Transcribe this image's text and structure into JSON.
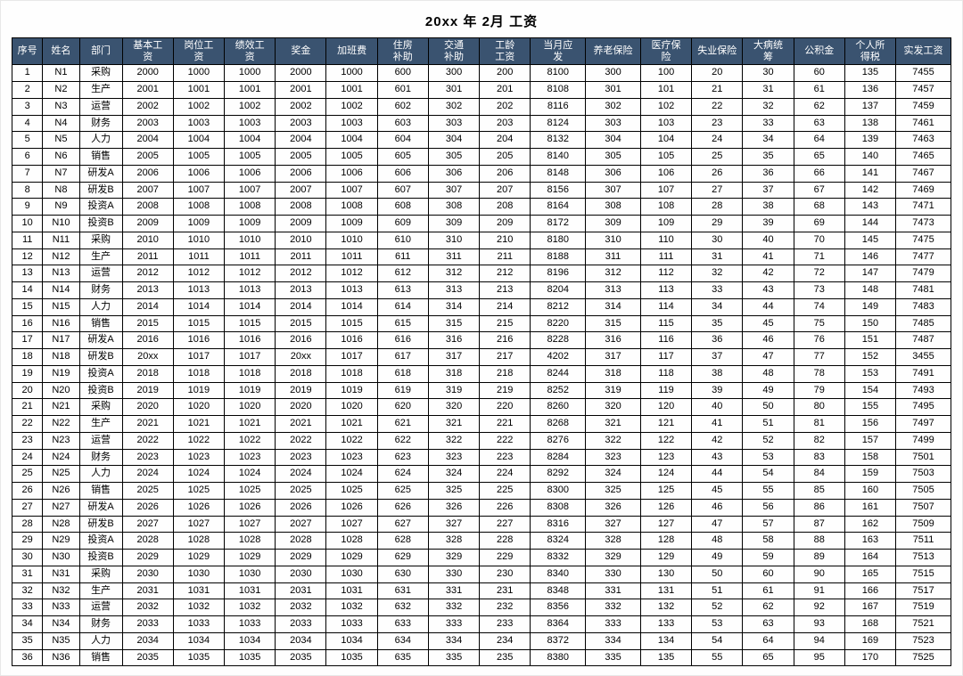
{
  "title": "20xx  年  2月 工资",
  "headers": [
    "序号",
    "姓名",
    "部门",
    "基本工资",
    "岗位工资",
    "绩效工资",
    "奖金",
    "加班费",
    "住房补助",
    "交通补助",
    "工龄工资",
    "当月应发",
    "养老保险",
    "医疗保险",
    "失业保险",
    "大病统筹",
    "公积金",
    "个人所得税",
    "实发工资"
  ],
  "rows": [
    [
      1,
      "N1",
      "采购",
      2000,
      1000,
      1000,
      2000,
      1000,
      600,
      300,
      200,
      8100,
      300,
      100,
      20,
      30,
      60,
      135,
      7455
    ],
    [
      2,
      "N2",
      "生产",
      2001,
      1001,
      1001,
      2001,
      1001,
      601,
      301,
      201,
      8108,
      301,
      101,
      21,
      31,
      61,
      136,
      7457
    ],
    [
      3,
      "N3",
      "运营",
      2002,
      1002,
      1002,
      2002,
      1002,
      602,
      302,
      202,
      8116,
      302,
      102,
      22,
      32,
      62,
      137,
      7459
    ],
    [
      4,
      "N4",
      "财务",
      2003,
      1003,
      1003,
      2003,
      1003,
      603,
      303,
      203,
      8124,
      303,
      103,
      23,
      33,
      63,
      138,
      7461
    ],
    [
      5,
      "N5",
      "人力",
      2004,
      1004,
      1004,
      2004,
      1004,
      604,
      304,
      204,
      8132,
      304,
      104,
      24,
      34,
      64,
      139,
      7463
    ],
    [
      6,
      "N6",
      "销售",
      2005,
      1005,
      1005,
      2005,
      1005,
      605,
      305,
      205,
      8140,
      305,
      105,
      25,
      35,
      65,
      140,
      7465
    ],
    [
      7,
      "N7",
      "研发A",
      2006,
      1006,
      1006,
      2006,
      1006,
      606,
      306,
      206,
      8148,
      306,
      106,
      26,
      36,
      66,
      141,
      7467
    ],
    [
      8,
      "N8",
      "研发B",
      2007,
      1007,
      1007,
      2007,
      1007,
      607,
      307,
      207,
      8156,
      307,
      107,
      27,
      37,
      67,
      142,
      7469
    ],
    [
      9,
      "N9",
      "投资A",
      2008,
      1008,
      1008,
      2008,
      1008,
      608,
      308,
      208,
      8164,
      308,
      108,
      28,
      38,
      68,
      143,
      7471
    ],
    [
      10,
      "N10",
      "投资B",
      2009,
      1009,
      1009,
      2009,
      1009,
      609,
      309,
      209,
      8172,
      309,
      109,
      29,
      39,
      69,
      144,
      7473
    ],
    [
      11,
      "N11",
      "采购",
      2010,
      1010,
      1010,
      2010,
      1010,
      610,
      310,
      210,
      8180,
      310,
      110,
      30,
      40,
      70,
      145,
      7475
    ],
    [
      12,
      "N12",
      "生产",
      2011,
      1011,
      1011,
      2011,
      1011,
      611,
      311,
      211,
      8188,
      311,
      111,
      31,
      41,
      71,
      146,
      7477
    ],
    [
      13,
      "N13",
      "运营",
      2012,
      1012,
      1012,
      2012,
      1012,
      612,
      312,
      212,
      8196,
      312,
      112,
      32,
      42,
      72,
      147,
      7479
    ],
    [
      14,
      "N14",
      "财务",
      2013,
      1013,
      1013,
      2013,
      1013,
      613,
      313,
      213,
      8204,
      313,
      113,
      33,
      43,
      73,
      148,
      7481
    ],
    [
      15,
      "N15",
      "人力",
      2014,
      1014,
      1014,
      2014,
      1014,
      614,
      314,
      214,
      8212,
      314,
      114,
      34,
      44,
      74,
      149,
      7483
    ],
    [
      16,
      "N16",
      "销售",
      2015,
      1015,
      1015,
      2015,
      1015,
      615,
      315,
      215,
      8220,
      315,
      115,
      35,
      45,
      75,
      150,
      7485
    ],
    [
      17,
      "N17",
      "研发A",
      2016,
      1016,
      1016,
      2016,
      1016,
      616,
      316,
      216,
      8228,
      316,
      116,
      36,
      46,
      76,
      151,
      7487
    ],
    [
      18,
      "N18",
      "研发B",
      "20xx",
      1017,
      1017,
      "20xx",
      1017,
      617,
      317,
      217,
      4202,
      317,
      117,
      37,
      47,
      77,
      152,
      3455
    ],
    [
      19,
      "N19",
      "投资A",
      2018,
      1018,
      1018,
      2018,
      1018,
      618,
      318,
      218,
      8244,
      318,
      118,
      38,
      48,
      78,
      153,
      7491
    ],
    [
      20,
      "N20",
      "投资B",
      2019,
      1019,
      1019,
      2019,
      1019,
      619,
      319,
      219,
      8252,
      319,
      119,
      39,
      49,
      79,
      154,
      7493
    ],
    [
      21,
      "N21",
      "采购",
      2020,
      1020,
      1020,
      2020,
      1020,
      620,
      320,
      220,
      8260,
      320,
      120,
      40,
      50,
      80,
      155,
      7495
    ],
    [
      22,
      "N22",
      "生产",
      2021,
      1021,
      1021,
      2021,
      1021,
      621,
      321,
      221,
      8268,
      321,
      121,
      41,
      51,
      81,
      156,
      7497
    ],
    [
      23,
      "N23",
      "运营",
      2022,
      1022,
      1022,
      2022,
      1022,
      622,
      322,
      222,
      8276,
      322,
      122,
      42,
      52,
      82,
      157,
      7499
    ],
    [
      24,
      "N24",
      "财务",
      2023,
      1023,
      1023,
      2023,
      1023,
      623,
      323,
      223,
      8284,
      323,
      123,
      43,
      53,
      83,
      158,
      7501
    ],
    [
      25,
      "N25",
      "人力",
      2024,
      1024,
      1024,
      2024,
      1024,
      624,
      324,
      224,
      8292,
      324,
      124,
      44,
      54,
      84,
      159,
      7503
    ],
    [
      26,
      "N26",
      "销售",
      2025,
      1025,
      1025,
      2025,
      1025,
      625,
      325,
      225,
      8300,
      325,
      125,
      45,
      55,
      85,
      160,
      7505
    ],
    [
      27,
      "N27",
      "研发A",
      2026,
      1026,
      1026,
      2026,
      1026,
      626,
      326,
      226,
      8308,
      326,
      126,
      46,
      56,
      86,
      161,
      7507
    ],
    [
      28,
      "N28",
      "研发B",
      2027,
      1027,
      1027,
      2027,
      1027,
      627,
      327,
      227,
      8316,
      327,
      127,
      47,
      57,
      87,
      162,
      7509
    ],
    [
      29,
      "N29",
      "投资A",
      2028,
      1028,
      1028,
      2028,
      1028,
      628,
      328,
      228,
      8324,
      328,
      128,
      48,
      58,
      88,
      163,
      7511
    ],
    [
      30,
      "N30",
      "投资B",
      2029,
      1029,
      1029,
      2029,
      1029,
      629,
      329,
      229,
      8332,
      329,
      129,
      49,
      59,
      89,
      164,
      7513
    ],
    [
      31,
      "N31",
      "采购",
      2030,
      1030,
      1030,
      2030,
      1030,
      630,
      330,
      230,
      8340,
      330,
      130,
      50,
      60,
      90,
      165,
      7515
    ],
    [
      32,
      "N32",
      "生产",
      2031,
      1031,
      1031,
      2031,
      1031,
      631,
      331,
      231,
      8348,
      331,
      131,
      51,
      61,
      91,
      166,
      7517
    ],
    [
      33,
      "N33",
      "运营",
      2032,
      1032,
      1032,
      2032,
      1032,
      632,
      332,
      232,
      8356,
      332,
      132,
      52,
      62,
      92,
      167,
      7519
    ],
    [
      34,
      "N34",
      "财务",
      2033,
      1033,
      1033,
      2033,
      1033,
      633,
      333,
      233,
      8364,
      333,
      133,
      53,
      63,
      93,
      168,
      7521
    ],
    [
      35,
      "N35",
      "人力",
      2034,
      1034,
      1034,
      2034,
      1034,
      634,
      334,
      234,
      8372,
      334,
      134,
      54,
      64,
      94,
      169,
      7523
    ],
    [
      36,
      "N36",
      "销售",
      2035,
      1035,
      1035,
      2035,
      1035,
      635,
      335,
      235,
      8380,
      335,
      135,
      55,
      65,
      95,
      170,
      7525
    ]
  ]
}
